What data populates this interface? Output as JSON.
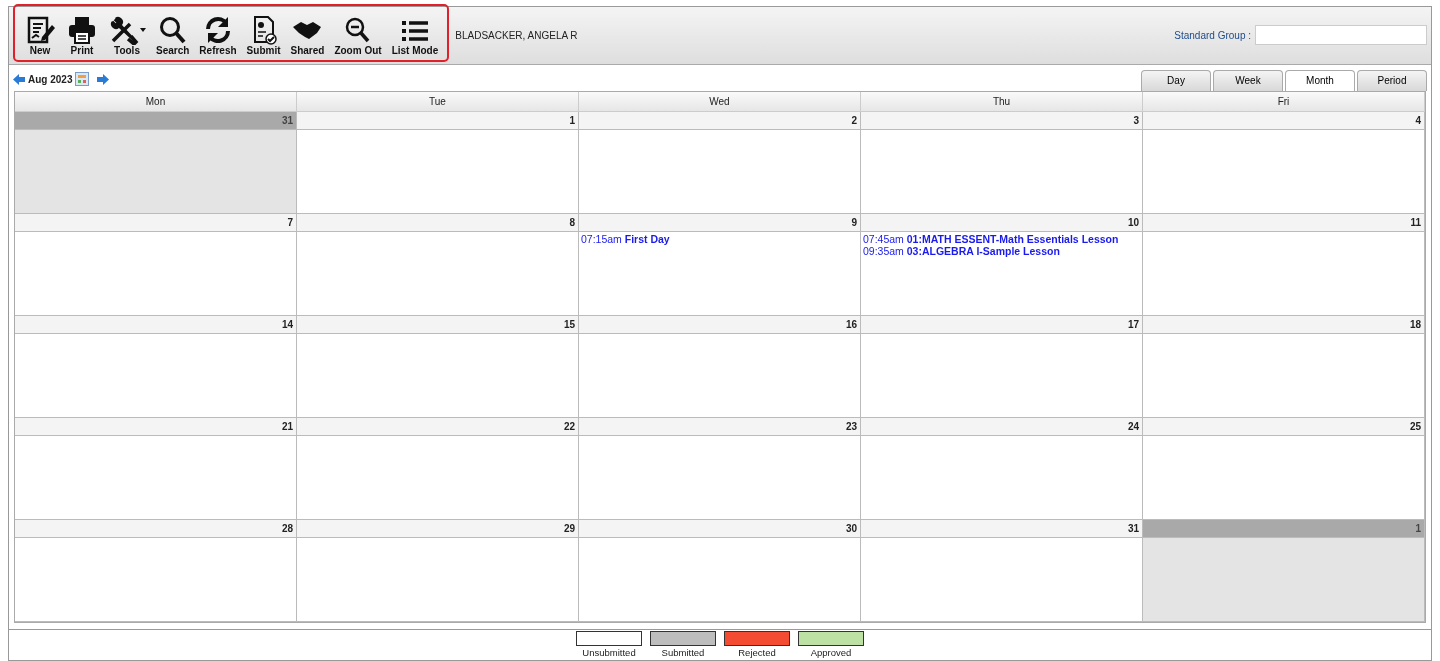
{
  "toolbar": [
    {
      "label": "New",
      "kind": "new",
      "dropdown": false
    },
    {
      "label": "Print",
      "kind": "print",
      "dropdown": false
    },
    {
      "label": "Tools",
      "kind": "tools",
      "dropdown": true
    },
    {
      "label": "Search",
      "kind": "search",
      "dropdown": false
    },
    {
      "label": "Refresh",
      "kind": "refresh",
      "dropdown": false
    },
    {
      "label": "Submit",
      "kind": "submit",
      "dropdown": false
    },
    {
      "label": "Shared",
      "kind": "shared",
      "dropdown": false
    },
    {
      "label": "Zoom Out",
      "kind": "zoomout",
      "dropdown": false
    },
    {
      "label": "List Mode",
      "kind": "list",
      "dropdown": false
    }
  ],
  "user_name": "BLADSACKER, ANGELA R",
  "standard_group": {
    "label": "Standard Group :"
  },
  "month_label": "Aug 2023",
  "view_tabs": [
    {
      "label": "Day",
      "selected": false
    },
    {
      "label": "Week",
      "selected": false
    },
    {
      "label": "Month",
      "selected": true
    },
    {
      "label": "Period",
      "selected": false
    }
  ],
  "weekdays": [
    "Mon",
    "Tue",
    "Wed",
    "Thu",
    "Fri"
  ],
  "weeks": [
    [
      {
        "day": "31",
        "other_month": true
      },
      {
        "day": "1",
        "other_month": false
      },
      {
        "day": "2",
        "other_month": false
      },
      {
        "day": "3",
        "other_month": false
      },
      {
        "day": "4",
        "other_month": false
      }
    ],
    [
      {
        "day": "7",
        "other_month": false
      },
      {
        "day": "8",
        "other_month": false
      },
      {
        "day": "9",
        "other_month": false,
        "events": [
          {
            "time": "07:15am",
            "title": "First Day"
          }
        ]
      },
      {
        "day": "10",
        "other_month": false,
        "events": [
          {
            "time": "07:45am",
            "title": "01:MATH ESSENT-Math Essentials Lesson"
          },
          {
            "time": "09:35am",
            "title": "03:ALGEBRA I-Sample Lesson"
          }
        ]
      },
      {
        "day": "11",
        "other_month": false
      }
    ],
    [
      {
        "day": "14",
        "other_month": false
      },
      {
        "day": "15",
        "other_month": false
      },
      {
        "day": "16",
        "other_month": false
      },
      {
        "day": "17",
        "other_month": false
      },
      {
        "day": "18",
        "other_month": false
      }
    ],
    [
      {
        "day": "21",
        "other_month": false
      },
      {
        "day": "22",
        "other_month": false
      },
      {
        "day": "23",
        "other_month": false
      },
      {
        "day": "24",
        "other_month": false
      },
      {
        "day": "25",
        "other_month": false
      }
    ],
    [
      {
        "day": "28",
        "other_month": false
      },
      {
        "day": "29",
        "other_month": false
      },
      {
        "day": "30",
        "other_month": false
      },
      {
        "day": "31",
        "other_month": false
      },
      {
        "day": "1",
        "other_month": true
      }
    ]
  ],
  "legend": [
    {
      "label": "Unsubmitted",
      "color": "#ffffff"
    },
    {
      "label": "Submitted",
      "color": "#bdbdbd"
    },
    {
      "label": "Rejected",
      "color": "#f44b33"
    },
    {
      "label": "Approved",
      "color": "#bde0a5"
    }
  ]
}
